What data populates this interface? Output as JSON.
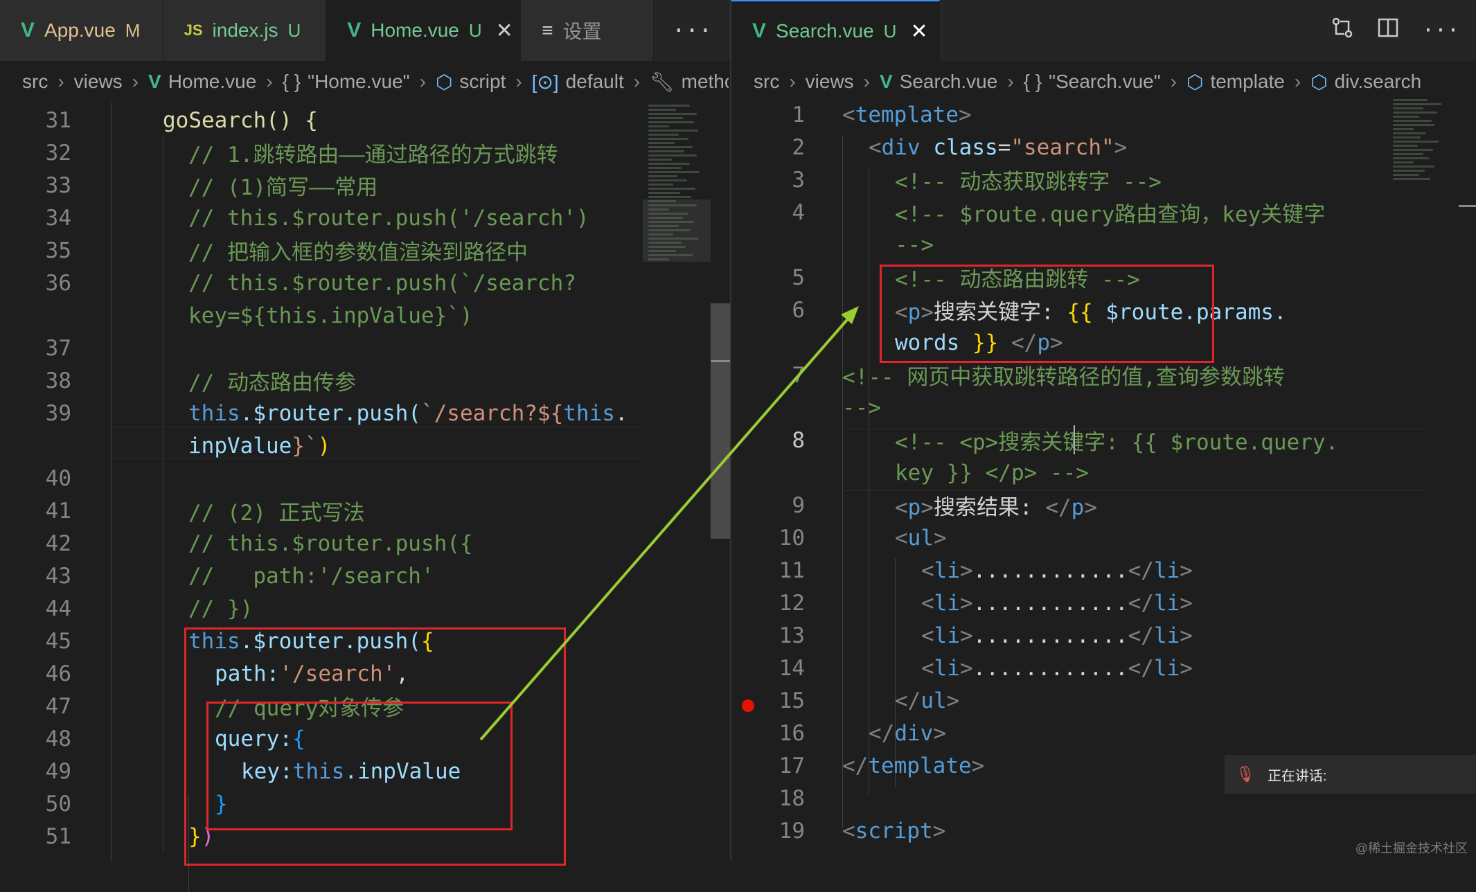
{
  "tabs_left": [
    {
      "label": "App.vue",
      "badge": "M",
      "icon": "vue-icon",
      "state": "modified"
    },
    {
      "label": "index.js",
      "badge": "U",
      "icon": "js-icon",
      "state": "untracked"
    },
    {
      "label": "Home.vue",
      "badge": "U",
      "icon": "vue-icon",
      "state": "untracked",
      "active": true
    },
    {
      "label": "设置",
      "icon": "settings-list-icon"
    }
  ],
  "tabs_right": [
    {
      "label": "Search.vue",
      "badge": "U",
      "icon": "vue-icon",
      "active": true
    }
  ],
  "more_label": "···",
  "breadcrumb_left": [
    "src",
    "views",
    "Home.vue",
    "\"Home.vue\"",
    "script",
    "default",
    "metho"
  ],
  "breadcrumb_right": [
    "src",
    "views",
    "Search.vue",
    "\"Search.vue\"",
    "template",
    "div.search"
  ],
  "left_line_numbers": [
    "31",
    "32",
    "33",
    "34",
    "35",
    "36",
    "",
    "37",
    "38",
    "39",
    "",
    "40",
    "41",
    "42",
    "43",
    "44",
    "45",
    "46",
    "47",
    "48",
    "49",
    "50",
    "51"
  ],
  "right_line_numbers": [
    "1",
    "2",
    "3",
    "4",
    "",
    "5",
    "6",
    "",
    "7",
    "",
    "8",
    "",
    "9",
    "10",
    "11",
    "12",
    "13",
    "14",
    "15",
    "16",
    "17",
    "18",
    "19"
  ],
  "left_code": {
    "l31": "goSearch() {",
    "l32": "// 1.跳转路由——通过路径的方式跳转",
    "l33": "// (1)简写——常用",
    "l34": "// this.$router.push('/search')",
    "l35": "// 把输入框的参数值渲染到路径中",
    "l36a": "// this.$router.push(`/search?",
    "l36b": "key=${this.inpValue}`)",
    "l38": "// 动态路由传参",
    "l39a_kw": "this",
    "l39a_rest": ".$router.push(",
    "l39a_str": "`/search?${",
    "l39a_this": "this",
    "l39a_dot": ".",
    "l39b_var": "inpValue",
    "l39b_str": "}`",
    "l39b_close": ")",
    "l41": "// (2) 正式写法",
    "l42": "// this.$router.push({",
    "l43": "//   path:'/search'",
    "l44": "// })",
    "l45_kw": "this",
    "l45_rest": ".$router.push(",
    "l45_br": "{",
    "l46_key": "path:",
    "l46_str": "'/search'",
    "l46_comma": ",",
    "l47": "// query对象传参",
    "l48_key": "query:",
    "l48_br": "{",
    "l49_key": "key:",
    "l49_kw": "this",
    "l49_var": ".inpValue",
    "l50": "}",
    "l51a": "}",
    "l51b": ")"
  },
  "right_code": {
    "r1": "template",
    "r2_tag": "div",
    "r2_attr": "class",
    "r2_val": "\"search\"",
    "r3": "<!-- 动态获取跳转字 -->",
    "r4": "<!-- $route.query路由查询，key关键字",
    "r4b": "-->",
    "r5": "<!-- 动态路由跳转 -->",
    "r6_tag": "p",
    "r6_text": "搜索关键字: ",
    "r6_open": "{{",
    "r6_var": " $route.params.",
    "r6b_var": "words",
    "r6b_close": " }}",
    "r7": "<!-- 网页中获取跳转路径的值,查询参数跳转",
    "r7b": "-->",
    "r8": "<!-- <p>搜索关键字: {{ $route.query.",
    "r8b": "key }} </p> -->",
    "r9_tag": "p",
    "r9_text": "搜索结果: ",
    "r10": "ul",
    "li_tag": "li",
    "li_dots": "............",
    "r15": "ul",
    "r16": "div",
    "r17": "template",
    "r19": "script"
  },
  "notification": {
    "text": "正在讲话:",
    "icon": "mic-muted-icon"
  },
  "watermark": "@稀土掘金技术社区",
  "colors": {
    "annotation_box": "#e0262b",
    "arrow": "#9acd32",
    "breakpoint": "#e51400"
  }
}
